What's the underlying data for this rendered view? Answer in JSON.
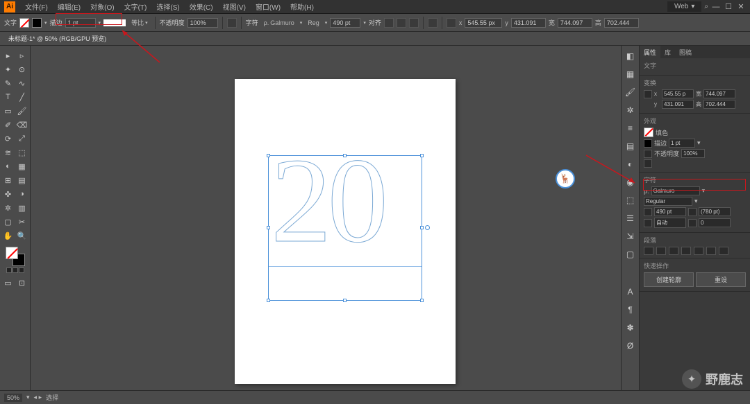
{
  "menubar": {
    "logo": "Ai",
    "items": [
      "文件(F)",
      "编辑(E)",
      "对象(O)",
      "文字(T)",
      "选择(S)",
      "效果(C)",
      "视图(V)",
      "窗口(W)",
      "帮助(H)"
    ],
    "workspace": "Web",
    "search_icon": "⌕"
  },
  "ctrlbar": {
    "tool_label": "文字",
    "stroke_label": "描边",
    "stroke_weight": "1 pt",
    "stroke_profile": "等比",
    "opacity_label": "不透明度",
    "opacity_value": "100%",
    "char_label": "字符",
    "font_family": "Galmuro",
    "font_style": "Reg",
    "font_size": "490 pt",
    "align_label": "对齐",
    "transform_x_label": "x",
    "transform_x": "545.55 px",
    "transform_y_label": "y",
    "transform_y": "431.091",
    "transform_w_label": "宽",
    "transform_w": "744.097",
    "transform_h_label": "高",
    "transform_h": "702.444"
  },
  "tab": {
    "title": "未标题-1* @ 50% (RGB/GPU 预览)"
  },
  "canvas": {
    "text": "20"
  },
  "panels": {
    "tabs": [
      "属性",
      "库",
      "图稿"
    ],
    "sect_doc": "文字",
    "sect_transform": "变换",
    "tf_x": "545.55 p",
    "tf_w": "744.097",
    "tf_y": "431.091",
    "tf_h": "702.444",
    "sect_appearance": "外观",
    "ap_fill": "填色",
    "ap_stroke": "描边",
    "ap_stroke_w": "1 pt",
    "ap_opacity": "不透明度",
    "ap_opacity_v": "100%",
    "sect_char": "字符",
    "font_family": "Galmuro",
    "font_style": "Regular",
    "font_size": "490 pt",
    "leading": "(780 pt)",
    "tracking_a": "自动",
    "tracking_b": "0",
    "sect_para": "段落",
    "sect_actions": "快速操作",
    "btn_create": "创建轮廓",
    "btn_reset": "重设"
  },
  "status": {
    "zoom": "50%",
    "tool": "选择"
  },
  "watermark": "野鹿志"
}
